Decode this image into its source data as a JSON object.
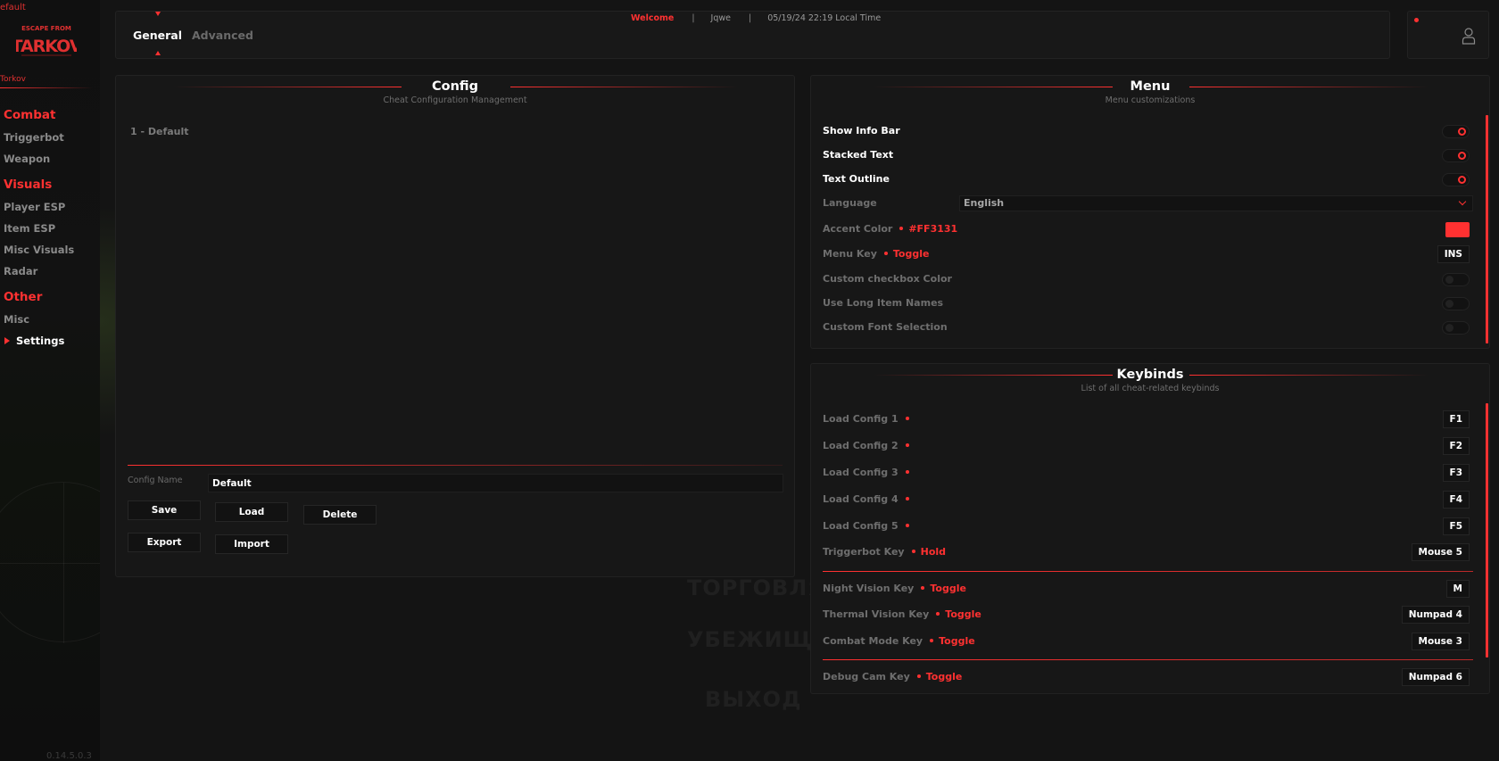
{
  "sidebar": {
    "profile_tag": "efault",
    "game_tag": "Torkov",
    "logo_text_top": "ESCAPE FROM",
    "logo_text_main": "TARKOV",
    "categories": [
      {
        "label": "Combat",
        "items": [
          "Triggerbot",
          "Weapon"
        ]
      },
      {
        "label": "Visuals",
        "items": [
          "Player ESP",
          "Item ESP",
          "Misc Visuals",
          "Radar"
        ]
      },
      {
        "label": "Other",
        "items": [
          "Misc",
          "Settings"
        ]
      }
    ],
    "active_item": "Settings",
    "version": "0.14.5.0.3"
  },
  "topbar": {
    "tabs": [
      {
        "label": "General",
        "active": true
      },
      {
        "label": "Advanced",
        "active": false
      }
    ],
    "welcome": "Welcome",
    "separator": "|",
    "username": "Jqwe",
    "datetime": "05/19/24 22:19 Local Time"
  },
  "config": {
    "title": "Config",
    "subtitle": "Cheat Configuration Management",
    "entries": [
      "1 - Default"
    ],
    "name_label": "Config Name",
    "name_value": "Default",
    "buttons": {
      "save": "Save",
      "load": "Load",
      "delete": "Delete",
      "export": "Export",
      "import": "Import"
    }
  },
  "menu": {
    "title": "Menu",
    "subtitle": "Menu customizations",
    "rows": {
      "show_info_bar": {
        "label": "Show Info Bar",
        "enabled": true
      },
      "stacked_text": {
        "label": "Stacked Text",
        "enabled": true
      },
      "text_outline": {
        "label": "Text Outline",
        "enabled": true
      },
      "language": {
        "label": "Language",
        "value": "English"
      },
      "accent_color": {
        "label": "Accent Color",
        "value": "#FF3131"
      },
      "menu_key": {
        "label": "Menu Key",
        "mode": "Toggle",
        "key": "INS"
      },
      "custom_checkbox_color": {
        "label": "Custom checkbox Color",
        "enabled": false
      },
      "use_long_item_names": {
        "label": "Use Long Item Names",
        "enabled": false
      },
      "custom_font_selection": {
        "label": "Custom Font Selection",
        "enabled": false
      }
    }
  },
  "keybinds": {
    "title": "Keybinds",
    "subtitle": "List of all cheat-related keybinds",
    "rows": [
      {
        "label": "Load Config 1",
        "mode": "",
        "key": "F1"
      },
      {
        "label": "Load Config 2",
        "mode": "",
        "key": "F2"
      },
      {
        "label": "Load Config 3",
        "mode": "",
        "key": "F3"
      },
      {
        "label": "Load Config 4",
        "mode": "",
        "key": "F4"
      },
      {
        "label": "Load Config 5",
        "mode": "",
        "key": "F5"
      },
      {
        "label": "Triggerbot Key",
        "mode": "Hold",
        "key": "Mouse 5"
      },
      {
        "label": "Night Vision Key",
        "mode": "Toggle",
        "key": "M"
      },
      {
        "label": "Thermal Vision Key",
        "mode": "Toggle",
        "key": "Numpad 4"
      },
      {
        "label": "Combat Mode Key",
        "mode": "Toggle",
        "key": "Mouse 3"
      },
      {
        "label": "Debug Cam Key",
        "mode": "Toggle",
        "key": "Numpad 6"
      }
    ]
  },
  "background_menu": [
    "ТОРГОВЛЯ",
    "УБЕЖИЩЕ",
    "ВЫХОД"
  ],
  "colors": {
    "accent": "#FF3131",
    "background": "#141414",
    "panel": "#171717"
  }
}
